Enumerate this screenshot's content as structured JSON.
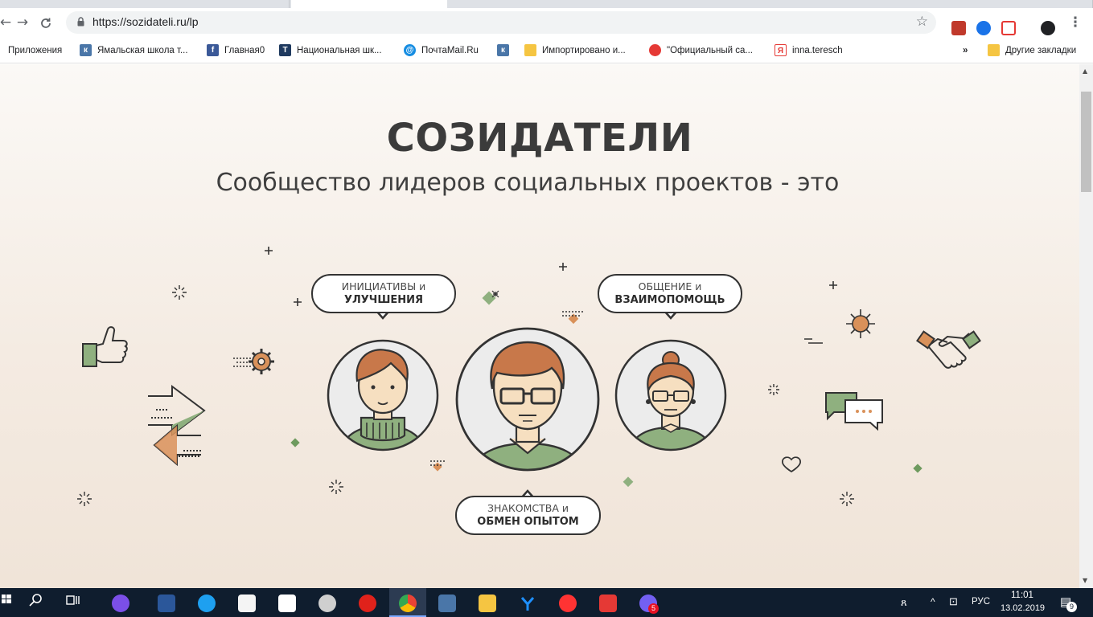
{
  "browser": {
    "url": "https://sozidateli.ru/lp",
    "bookmarks": [
      {
        "label": "Приложения",
        "icon": "apps-grid-icon",
        "color": "#4285f4"
      },
      {
        "label": "Ямальская школа т...",
        "icon": "vk-icon",
        "color": "#4a76a8"
      },
      {
        "label": "Главная0",
        "icon": "facebook-icon",
        "color": "#3b5998"
      },
      {
        "label": "Национальная шк...",
        "icon": "t-logo-icon",
        "color": "#1f3a5f"
      },
      {
        "label": "ПочтаMail.Ru",
        "icon": "mail-ru-icon",
        "color": "#168de2"
      },
      {
        "label": "",
        "icon": "vk-icon",
        "color": "#4a76a8"
      },
      {
        "label": "Импортировано и...",
        "icon": "folder-icon",
        "color": "#f5c542"
      },
      {
        "label": "\"Официальный са...",
        "icon": "site-icon",
        "color": "#e53935"
      },
      {
        "label": "inna.teresch",
        "icon": "yandex-icon",
        "color": "#ffffff"
      }
    ],
    "overflow_label": "»",
    "other_bookmarks": "Другие закладки"
  },
  "hero": {
    "title": "СОЗИДАТЕЛИ",
    "subtitle": "Сообщество лидеров социальных проектов - это"
  },
  "bubbles": {
    "initiatives": {
      "line1": "ИНИЦИАТИВЫ и",
      "line2": "УЛУЧШЕНИЯ"
    },
    "communication": {
      "line1": "ОБЩЕНИЕ и",
      "line2": "ВЗАИМОПОМОЩЬ"
    },
    "acquaintance": {
      "line1": "ЗНАКОМСТВА и",
      "line2": "ОБМЕН ОПЫТОМ"
    }
  },
  "colors": {
    "accent_green": "#8fb07f",
    "accent_orange": "#d9915a",
    "outline": "#333333",
    "hair": "#c8784a",
    "skin": "#f6dfc0"
  },
  "taskbar": {
    "language": "РУС",
    "time": "11:01",
    "date": "13.02.2019",
    "notifications_badge": "9",
    "viber_badge": "5"
  }
}
